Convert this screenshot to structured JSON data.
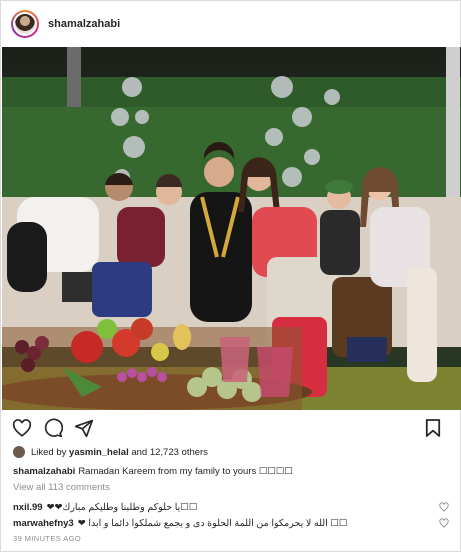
{
  "post": {
    "username": "shamalzahabi",
    "likes_prefix": "Liked by",
    "liked_by_user": "yasmin_helal",
    "likes_suffix": "and 12,723 others",
    "caption_text": "Ramadan Kareem from my family to yours ☐☐☐☐",
    "view_comments": "View all 113 comments",
    "timestamp": "39 MINUTES AGO"
  },
  "comments": [
    {
      "user": "nxil.99",
      "text": "❤❤يا حلوكم وطلبنا وطليكم مبارك☐☐"
    },
    {
      "user": "marwahefny3",
      "text": "❤ الله لا يحرمكوا من اللمة الحلوة دى و يجمع شملكوا دائما و ابدا ☐☐"
    }
  ],
  "icons": {
    "like": "heart-icon",
    "comment": "comment-icon",
    "share": "share-icon",
    "save": "bookmark-icon"
  }
}
